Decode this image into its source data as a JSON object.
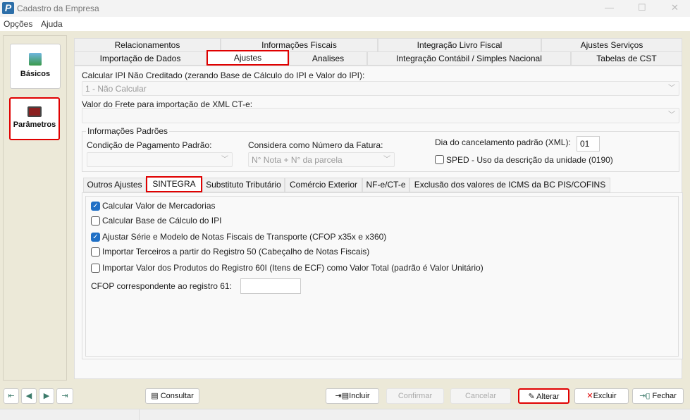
{
  "window": {
    "title": "Cadastro da Empresa",
    "logo": "P"
  },
  "menu": [
    "Opções",
    "Ajuda"
  ],
  "sidebar": {
    "items": [
      {
        "label": "Básicos",
        "icon": "basics-icon"
      },
      {
        "label": "Parâmetros",
        "icon": "parameters-icon"
      }
    ]
  },
  "tabs_row1": [
    "Relacionamentos",
    "Informações Fiscais",
    "Integração Livro Fiscal",
    "Ajustes Serviços"
  ],
  "tabs_row2": [
    "Importação de Dados",
    "Ajustes",
    "Analises",
    "Integração Contábil / Simples Nacional",
    "Tabelas de CST"
  ],
  "form": {
    "ipi_label": "Calcular IPI Não Creditado (zerando Base de Cálculo do IPI e Valor do IPI):",
    "ipi_value": "1 - Não Calcular",
    "frete_label": "Valor do Frete para importação de XML CT-e:",
    "frete_value": "",
    "group_title": "Informações Padrões",
    "cond_label": "Condição de Pagamento Padrão:",
    "fatura_label": "Considera como Número da Fatura:",
    "fatura_value": "N° Nota + N° da parcela",
    "dia_label": "Dia do cancelamento padrão (XML):",
    "dia_value": "01",
    "sped_label": "SPED - Uso da descrição da unidade (0190)"
  },
  "inner_tabs": [
    "Outros Ajustes",
    "SINTEGRA",
    "Substituto Tributário",
    "Comércio Exterior",
    "NF-e/CT-e",
    "Exclusão dos valores de ICMS da BC PIS/COFINS"
  ],
  "sintegra": {
    "checks": [
      {
        "label": "Calcular Valor de  Mercadorias",
        "checked": true
      },
      {
        "label": "Calcular Base de Cálculo do  IPI",
        "checked": false
      },
      {
        "label": "Ajustar Série e Modelo de Notas Fiscais de Transporte (CFOP x35x e x360)",
        "checked": true
      },
      {
        "label": "Importar Terceiros a partir do Registro 50 (Cabeçalho de Notas Fiscais)",
        "checked": false
      },
      {
        "label": "Importar Valor dos Produtos do Registro 60I (Itens de ECF) como Valor Total (padrão é Valor Unitário)",
        "checked": false
      }
    ],
    "cfop_label": "CFOP correspondente ao registro 61:",
    "cfop_value": ""
  },
  "buttons": {
    "consultar": "Consultar",
    "incluir": "Incluir",
    "confirmar": "Confirmar",
    "cancelar": "Cancelar",
    "alterar": "Alterar",
    "excluir": "Excluir",
    "fechar": "Fechar"
  },
  "colors": {
    "highlight": "#e00000",
    "background": "#ECE9D8",
    "check": "#1f6fc5"
  }
}
